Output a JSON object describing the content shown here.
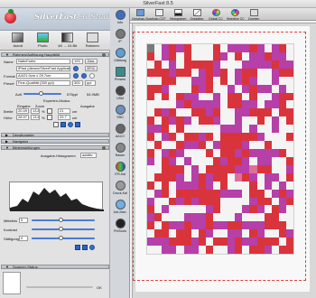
{
  "window_title": "SilverFast 8.5",
  "brand": {
    "name": "SilverFast",
    "suffix": "Ai Studio"
  },
  "modes": [
    {
      "label": "AutoIt"
    },
    {
      "label": "Photo"
    },
    {
      "label": "48 → 24 Bit"
    },
    {
      "label": "Rahmen"
    }
  ],
  "sections": {
    "frame": "Rahmen/Auflösung Hauptbild",
    "densitometer": "Densitometer",
    "navigator": "Navigator",
    "image_adjust": "Bildeinstellungen",
    "scanner_status": "Scanner-Status"
  },
  "frame": {
    "name_label": "Name",
    "name_value": "NativFarbe",
    "name_num": "193",
    "gen_btn": "Gen.",
    "save_label": "iPfad (dieses/SilverFast Application)",
    "save_btn": "EFIC",
    "format_label": "Format",
    "format_value": "A4/21.0cm x 29.7cm",
    "preset_label": "Preset",
    "preset_value": "Fine-Qualität (300 ppi)",
    "dpi_value": "300",
    "unit": "ppi",
    "aufl_label": "Aufl.",
    "aufl_value": "575ppi",
    "size_readout": "54.9MB",
    "exp_mode": "Experten-Modus",
    "col_in": "Eingabe",
    "col_zoom": "Zoom",
    "col_out": "Ausgabe",
    "width_label": "Breite",
    "width_in": "20.49",
    "zoom_w": "13.8",
    "lock": "%",
    "width_out": "21",
    "height_label": "Höhe",
    "height_in": "28.97",
    "zoom_h": "13.8",
    "height_out": "29.7",
    "unit_cm": "cm"
  },
  "adjust": {
    "histo_label": "Ausgabe-Histogramm",
    "histo_mode": "additiv",
    "midtones_label": "Mitteltön",
    "midtones_value": "0",
    "contrast_label": "Kontrast",
    "saturation_label": "Sättigung",
    "saturation_value": "0"
  },
  "scanner": {
    "ok": "OK"
  },
  "tools": [
    {
      "label": "Info"
    },
    {
      "label": "IP"
    },
    {
      "label": "Glättung"
    },
    {
      "label": "Presets"
    },
    {
      "label": "USM"
    },
    {
      "label": "SRD"
    },
    {
      "label": "AACO"
    },
    {
      "label": "Raster"
    },
    {
      "label": "ITR-Kal"
    },
    {
      "label": "Druck-Kal"
    },
    {
      "label": "Job-Man."
    },
    {
      "label": "PhtTools"
    }
  ],
  "toolbar": [
    {
      "label": "Vorschau-Scan"
    },
    {
      "label": "Auto-CCF"
    },
    {
      "label": "Histogramm"
    },
    {
      "label": "Gradation"
    },
    {
      "label": "Global CC"
    },
    {
      "label": "Selective CC"
    },
    {
      "label": "Zoomen"
    }
  ],
  "colors": {
    "accent": "#3a6fc4",
    "selection": "#e04040"
  }
}
